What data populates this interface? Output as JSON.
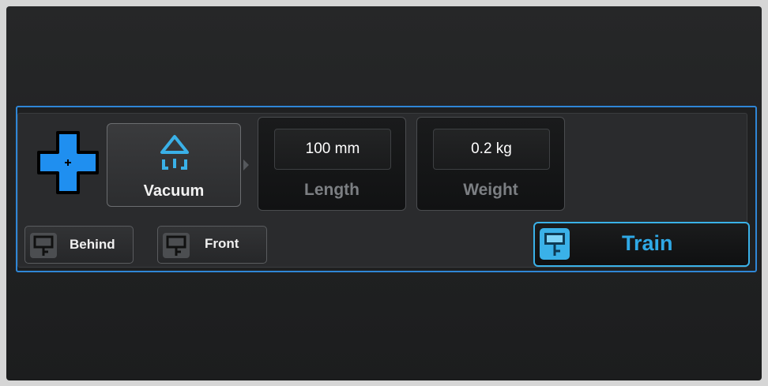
{
  "gripper": {
    "label": "Vacuum",
    "icon": "vacuum-gripper-icon"
  },
  "length": {
    "value": "100 mm",
    "label": "Length"
  },
  "weight": {
    "value": "0.2 kg",
    "label": "Weight"
  },
  "positions": {
    "behind": {
      "label": "Behind",
      "icon": "waypoint-icon"
    },
    "front": {
      "label": "Front",
      "icon": "waypoint-icon"
    }
  },
  "train": {
    "label": "Train",
    "icon": "waypoint-icon"
  },
  "add": {
    "icon": "add-cross-icon"
  },
  "colors": {
    "accent": "#2f86d6",
    "train": "#2fa9e6",
    "add": "#1f8ff0"
  }
}
